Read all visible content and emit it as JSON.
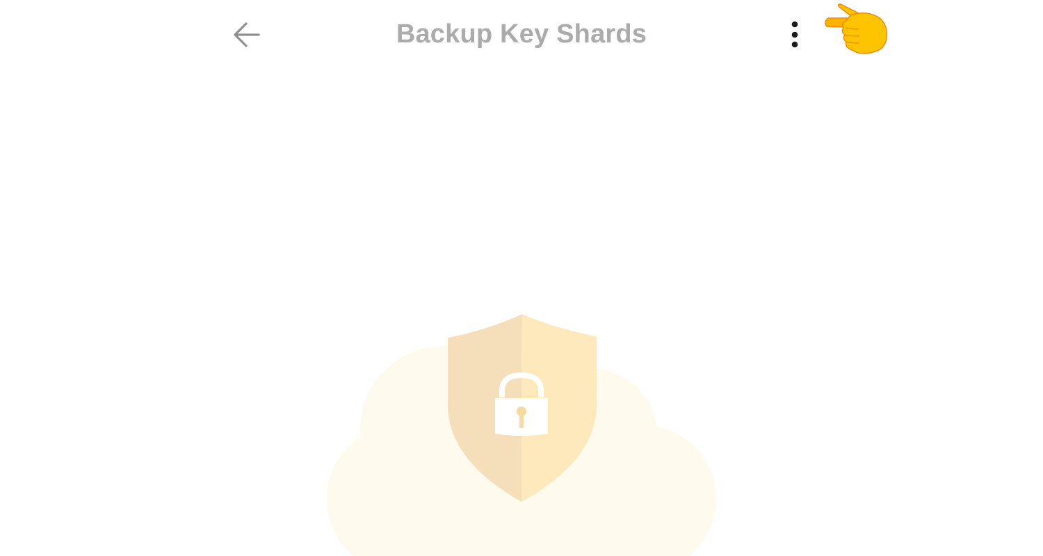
{
  "header": {
    "title": "Backup Key Shards",
    "back_icon": "arrow-left-icon",
    "more_icon": "more-vertical-icon"
  },
  "overlay": {
    "hand_icon": "pointing-hand-right-icon"
  },
  "illustration": {
    "icon": "cloud-shield-lock-icon"
  },
  "colors": {
    "title": "#ababab",
    "back_arrow": "#8f8f8f",
    "more_dots": "#1a1a1a",
    "cloud": "#fffaed",
    "shield_left": "#f5dfba",
    "shield_right": "#fde9bb",
    "hand_fill": "#ffc400",
    "hand_outline": "#f08a00"
  }
}
